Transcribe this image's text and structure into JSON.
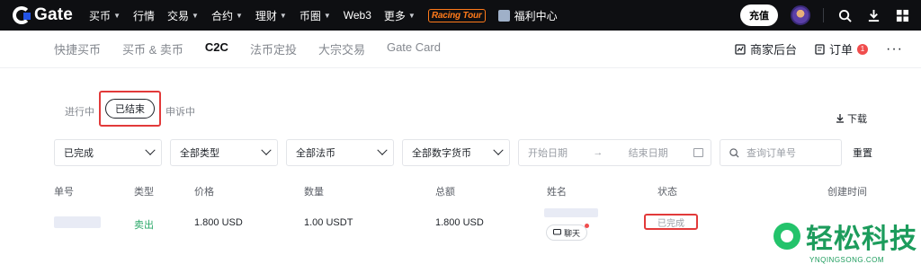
{
  "topnav": {
    "logo": "Gate",
    "items": [
      {
        "label": "买币",
        "caret": true
      },
      {
        "label": "行情",
        "caret": false
      },
      {
        "label": "交易",
        "caret": true
      },
      {
        "label": "合约",
        "caret": true
      },
      {
        "label": "理财",
        "caret": true
      },
      {
        "label": "币圈",
        "caret": true
      },
      {
        "label": "Web3",
        "caret": false
      },
      {
        "label": "更多",
        "caret": true
      }
    ],
    "racing": "Racing Tour",
    "welfare": "福利中心",
    "deposit": "充值"
  },
  "subnav": {
    "tabs": [
      "快捷买币",
      "买币 & 卖币",
      "C2C",
      "法币定投",
      "大宗交易",
      "Gate Card"
    ],
    "active_tab": "C2C",
    "merchant": "商家后台",
    "orders": "订单",
    "orders_badge": "1",
    "more": "···"
  },
  "status_tabs": {
    "in_progress": "进行中",
    "finished": "已结束",
    "appeal": "申诉中"
  },
  "download": "下载",
  "filters": {
    "status": "已完成",
    "type": "全部类型",
    "fiat": "全部法币",
    "crypto": "全部数字货币",
    "start_date": "开始日期",
    "end_date": "结束日期",
    "search_placeholder": "查询订单号",
    "reset": "重置"
  },
  "table": {
    "headers": [
      "单号",
      "类型",
      "价格",
      "数量",
      "总额",
      "姓名",
      "状态",
      "创建时间"
    ],
    "rows": [
      {
        "type": "卖出",
        "price": "1.800 USD",
        "quantity": "1.00 USDT",
        "total": "1.800 USD",
        "chat": "聊天",
        "status": "已完成"
      }
    ]
  },
  "watermark": {
    "title": "轻松科技",
    "sub": "YNQINGSONG.COM"
  }
}
